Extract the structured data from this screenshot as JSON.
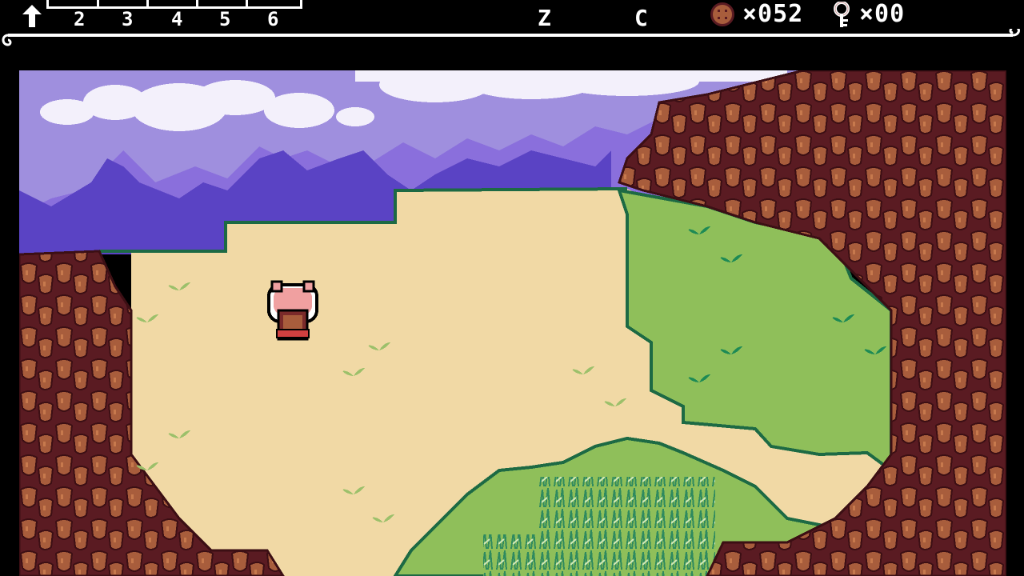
{
  "hud": {
    "slots": [
      "2",
      "3",
      "4",
      "5",
      "6"
    ],
    "buttons": {
      "z": "Z",
      "c": "C"
    },
    "coins": "×052",
    "keys": "×00",
    "icons": {
      "slot1": "up-arrow-icon",
      "currency": "coin-icon",
      "key": "key-icon"
    }
  },
  "colors": {
    "sky": "#9f8fde",
    "cloud": "#f3f0fb",
    "mountain_far": "#8a6fdc",
    "mountain_near": "#5a43c4",
    "sand": "#f1d9a5",
    "grass": "#8fbf5a",
    "grass_dark": "#1d6a44",
    "rock": "#a85d3c",
    "rock_dark": "#5a1b22",
    "player": "#f0a0a0"
  }
}
